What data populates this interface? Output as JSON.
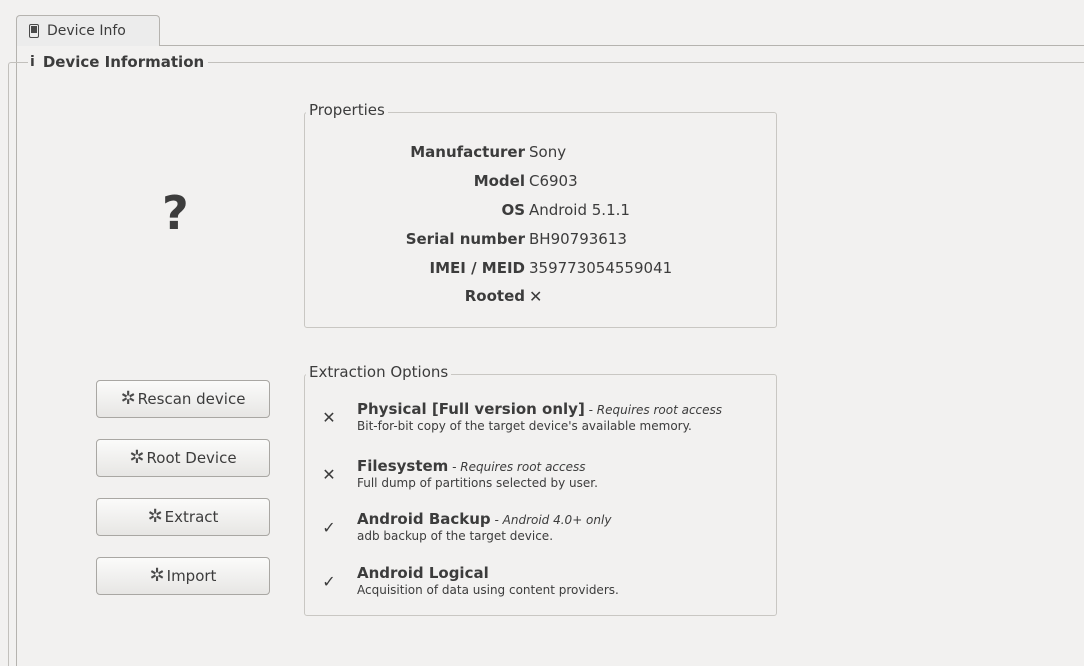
{
  "tab": {
    "label": "Device Info"
  },
  "main": {
    "group_title": "Device Information",
    "device_image_placeholder": "?"
  },
  "properties": {
    "title": "Properties",
    "rows": [
      {
        "key": "Manufacturer",
        "value": "Sony"
      },
      {
        "key": "Model",
        "value": "C6903"
      },
      {
        "key": "OS",
        "value": "Android 5.1.1"
      },
      {
        "key": "Serial number",
        "value": "BH90793613"
      },
      {
        "key": "IMEI / MEID",
        "value": "359773054559041"
      },
      {
        "key": "Rooted",
        "value": "✕"
      }
    ]
  },
  "extraction": {
    "title": "Extraction Options",
    "options": [
      {
        "status": "unavailable",
        "mark": "✕",
        "title": "Physical [Full version only]",
        "note": " - Requires root access",
        "description": "Bit-for-bit copy of the target device's available memory."
      },
      {
        "status": "unavailable",
        "mark": "✕",
        "title": "Filesystem",
        "note": " - Requires root access",
        "description": "Full dump of partitions selected by user."
      },
      {
        "status": "available",
        "mark": "✓",
        "title": "Android Backup",
        "note": " - Android 4.0+ only",
        "description": "adb backup of the target device."
      },
      {
        "status": "available",
        "mark": "✓",
        "title": "Android Logical",
        "note": "",
        "description": "Acquisition of data using content providers."
      }
    ]
  },
  "buttons": {
    "rescan": "Rescan device",
    "root": "Root Device",
    "extract": "Extract",
    "import": "Import",
    "icon": "gear-icon"
  }
}
